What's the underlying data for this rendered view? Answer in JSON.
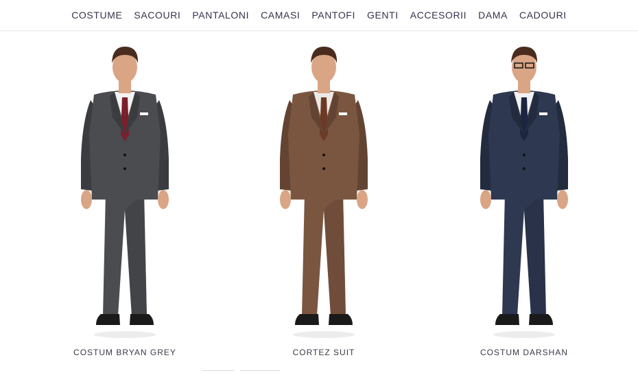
{
  "nav": {
    "items": [
      "COSTUME",
      "SACOURI",
      "PANTALONI",
      "CAMASI",
      "PANTOFI",
      "GENTI",
      "ACCESORII",
      "DAMA",
      "CADOURI"
    ]
  },
  "products": [
    {
      "name": "COSTUM BRYAN GREY",
      "suit_color": "#4a4c4f",
      "suit_shade": "#3a3c3f",
      "tie_color": "#7a1f2b",
      "shirt_color": "#f3f3f3",
      "glasses": false
    },
    {
      "name": "CORTEZ SUIT",
      "suit_color": "#7a5641",
      "suit_shade": "#634433",
      "tie_color": "#6b3a24",
      "shirt_color": "#ece8e6",
      "glasses": false
    },
    {
      "name": "COSTUM DARSHAN",
      "suit_color": "#2e3850",
      "suit_shade": "#232b3f",
      "tie_color": "#1c2540",
      "shirt_color": "#f2f2f2",
      "glasses": true
    }
  ],
  "colors": {
    "background": "#ffffff",
    "nav_text": "#34324a",
    "skin": "#d9a585",
    "hair": "#4a2c1e",
    "shoe": "#1a1a1a"
  }
}
